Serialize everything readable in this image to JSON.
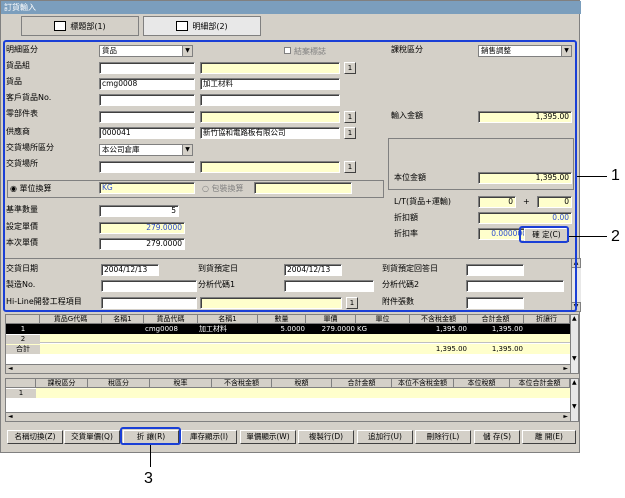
{
  "title": "訂貨輸入",
  "tabs": [
    {
      "label": "標題部(1)"
    },
    {
      "label": "明細部(2)"
    }
  ],
  "form": {
    "detail_type_label": "明細區分",
    "detail_type_value": "貨品",
    "close_check_label": "結案標誌",
    "tax_type_label": "課稅區分",
    "tax_type_value": "銷售調整",
    "item_group_label": "貨品組",
    "item_label": "貨品",
    "item_code": "cmg0008",
    "item_name": "加工材料",
    "cust_item_label": "客戶貨品No.",
    "part_table_label": "零部件表",
    "input_amount_label": "輸入金額",
    "input_amount_value": "1,395.00",
    "supplier_label": "供應商",
    "supplier_code": "000041",
    "supplier_name": "新竹協和電路板有限公司",
    "delivery_type_label": "交貨場所區分",
    "delivery_type_value": "本公司倉庫",
    "delivery_place_label": "交貨場所",
    "local_amount_label": "本位金額",
    "local_amount_value": "1,395.00",
    "unit_conv_label": "單位換算",
    "unit_value": "KG",
    "pack_conv_label": "包裝換算",
    "lt_label": "L/T(貨品+運輸)",
    "lt_a": "0",
    "lt_plus": "+",
    "lt_b": "0",
    "discount_amt_label": "折扣額",
    "discount_amt_value": "0.00",
    "discount_rate_label": "折扣率",
    "discount_rate_value": "0.000000",
    "confirm_label": "確 定(C)",
    "base_qty_label": "基準數量",
    "base_qty_value": "5",
    "set_price_label": "設定單價",
    "set_price_value": "279.0000",
    "this_price_label": "本次單價",
    "this_price_value": "279.0000",
    "delivery_date_label": "交貨日期",
    "delivery_date_value": "2004/12/13",
    "due_date_label": "到貨預定日",
    "due_date_value": "2004/12/13",
    "due_reply_label": "到貨預定回答日",
    "mfg_no_label": "製造No.",
    "analysis1_label": "分析代碼1",
    "analysis2_label": "分析代碼2",
    "hiline_label": "Hi-Line開發工程項目",
    "attach_label": "附件張數",
    "btn1": "1"
  },
  "grid1": {
    "headers": [
      "貨品G代碼",
      "名稱1",
      "貨品代碼",
      "名稱1",
      "數量",
      "單價",
      "單位",
      "不含稅金額",
      "合計金額",
      "折讓行"
    ],
    "rows": [
      {
        "no": "1",
        "cells": [
          "",
          "",
          "cmg0008",
          "加工材料",
          "5.0000",
          "279.0000",
          "KG",
          "1,395.00",
          "1,395.00",
          ""
        ]
      },
      {
        "no": "2",
        "cells": [
          "",
          "",
          "",
          "",
          "",
          "",
          "",
          "",
          "",
          ""
        ]
      }
    ],
    "total_label": "合計",
    "total_a": "1,395.00",
    "total_b": "1,395.00"
  },
  "grid2": {
    "headers": [
      "課稅區分",
      "稅區分",
      "稅率",
      "不含稅金額",
      "稅額",
      "合計金額",
      "本位不含稅金額",
      "本位稅額",
      "本位合計金額"
    ],
    "row_no": "1"
  },
  "buttons": [
    {
      "label": "名稱切換(Z)"
    },
    {
      "label": "交貨單價(Q)"
    },
    {
      "label": "折 讓(R)"
    },
    {
      "label": "庫存顯示(I)"
    },
    {
      "label": "單價顯示(W)"
    },
    {
      "label": "複製行(D)"
    },
    {
      "label": "追加行(U)"
    },
    {
      "label": "刪除行(L)"
    },
    {
      "label": "儲 存(S)"
    },
    {
      "label": "離 開(E)"
    }
  ],
  "callouts": [
    "1",
    "2",
    "3"
  ]
}
